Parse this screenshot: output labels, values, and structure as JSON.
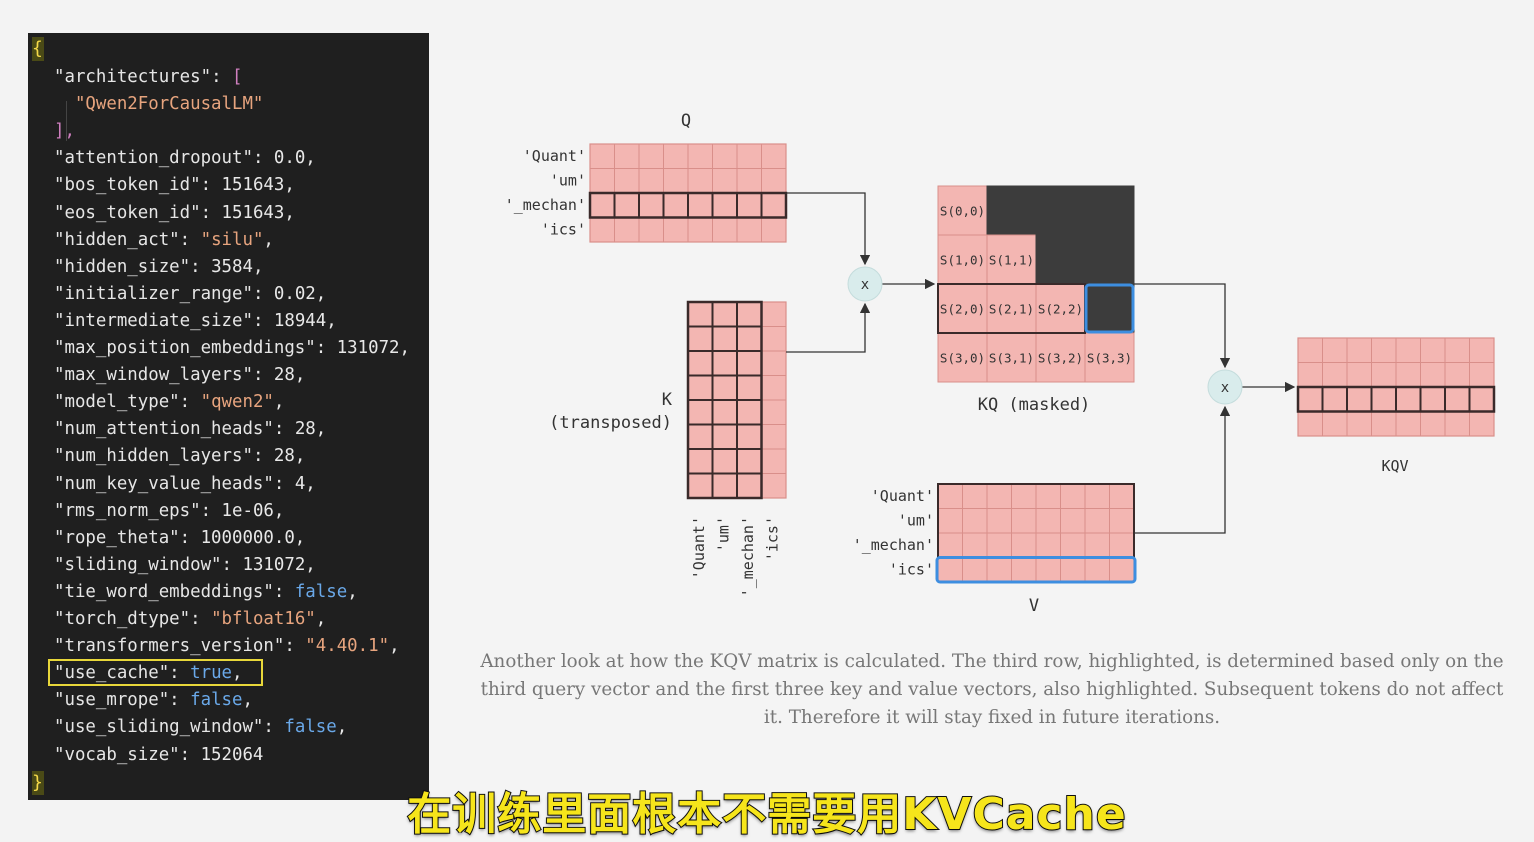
{
  "config_json": {
    "open_brace": "{",
    "close_brace": "}",
    "lines": [
      [
        {
          "t": "\"architectures\"",
          "c": "key"
        },
        {
          "t": ": ",
          "c": "num"
        },
        {
          "t": "[",
          "c": "bracket"
        }
      ],
      [
        {
          "t": "  \"Qwen2ForCausalLM\"",
          "c": "arr-str"
        }
      ],
      [
        {
          "t": "],",
          "c": "bracket"
        }
      ],
      [
        {
          "t": "\"attention_dropout\"",
          "c": "key"
        },
        {
          "t": ": 0.0,",
          "c": "num"
        }
      ],
      [
        {
          "t": "\"bos_token_id\"",
          "c": "key"
        },
        {
          "t": ": 151643,",
          "c": "num"
        }
      ],
      [
        {
          "t": "\"eos_token_id\"",
          "c": "key"
        },
        {
          "t": ": 151643,",
          "c": "num"
        }
      ],
      [
        {
          "t": "\"hidden_act\"",
          "c": "key"
        },
        {
          "t": ": ",
          "c": "num"
        },
        {
          "t": "\"silu\"",
          "c": "str"
        },
        {
          "t": ",",
          "c": "num"
        }
      ],
      [
        {
          "t": "\"hidden_size\"",
          "c": "key"
        },
        {
          "t": ": 3584,",
          "c": "num"
        }
      ],
      [
        {
          "t": "\"initializer_range\"",
          "c": "key"
        },
        {
          "t": ": 0.02,",
          "c": "num"
        }
      ],
      [
        {
          "t": "\"intermediate_size\"",
          "c": "key"
        },
        {
          "t": ": 18944,",
          "c": "num"
        }
      ],
      [
        {
          "t": "\"max_position_embeddings\"",
          "c": "key"
        },
        {
          "t": ": 131072,",
          "c": "num"
        }
      ],
      [
        {
          "t": "\"max_window_layers\"",
          "c": "key"
        },
        {
          "t": ": 28,",
          "c": "num"
        }
      ],
      [
        {
          "t": "\"model_type\"",
          "c": "key"
        },
        {
          "t": ": ",
          "c": "num"
        },
        {
          "t": "\"qwen2\"",
          "c": "str"
        },
        {
          "t": ",",
          "c": "num"
        }
      ],
      [
        {
          "t": "\"num_attention_heads\"",
          "c": "key"
        },
        {
          "t": ": 28,",
          "c": "num"
        }
      ],
      [
        {
          "t": "\"num_hidden_layers\"",
          "c": "key"
        },
        {
          "t": ": 28,",
          "c": "num"
        }
      ],
      [
        {
          "t": "\"num_key_value_heads\"",
          "c": "key"
        },
        {
          "t": ": 4,",
          "c": "num"
        }
      ],
      [
        {
          "t": "\"rms_norm_eps\"",
          "c": "key"
        },
        {
          "t": ": 1e-06,",
          "c": "num"
        }
      ],
      [
        {
          "t": "\"rope_theta\"",
          "c": "key"
        },
        {
          "t": ": 1000000.0,",
          "c": "num"
        }
      ],
      [
        {
          "t": "\"sliding_window\"",
          "c": "key"
        },
        {
          "t": ": 131072,",
          "c": "num"
        }
      ],
      [
        {
          "t": "\"tie_word_embeddings\"",
          "c": "key"
        },
        {
          "t": ": ",
          "c": "num"
        },
        {
          "t": "false",
          "c": "kw"
        },
        {
          "t": ",",
          "c": "num"
        }
      ],
      [
        {
          "t": "\"torch_dtype\"",
          "c": "key"
        },
        {
          "t": ": ",
          "c": "num"
        },
        {
          "t": "\"bfloat16\"",
          "c": "str"
        },
        {
          "t": ",",
          "c": "num"
        }
      ],
      [
        {
          "t": "\"transformers_version\"",
          "c": "key"
        },
        {
          "t": ": ",
          "c": "num"
        },
        {
          "t": "\"4.40.1\"",
          "c": "str"
        },
        {
          "t": ",",
          "c": "num"
        }
      ],
      [
        {
          "t": "\"use_cache\"",
          "c": "key"
        },
        {
          "t": ": ",
          "c": "num"
        },
        {
          "t": "true",
          "c": "kw"
        },
        {
          "t": ",",
          "c": "num"
        }
      ],
      [
        {
          "t": "\"use_mrope\"",
          "c": "key"
        },
        {
          "t": ": ",
          "c": "num"
        },
        {
          "t": "false",
          "c": "kw"
        },
        {
          "t": ",",
          "c": "num"
        }
      ],
      [
        {
          "t": "\"use_sliding_window\"",
          "c": "key"
        },
        {
          "t": ": ",
          "c": "num"
        },
        {
          "t": "false",
          "c": "kw"
        },
        {
          "t": ",",
          "c": "num"
        }
      ],
      [
        {
          "t": "\"vocab_size\"",
          "c": "key"
        },
        {
          "t": ": 152064",
          "c": "num"
        }
      ]
    ],
    "highlighted_line": 22
  },
  "diagram": {
    "q_label": "Q",
    "k_label_1": "K",
    "k_label_2": "(transposed)",
    "v_label": "V",
    "kq_label": "KQ (masked)",
    "kqv_label": "KQV",
    "multiply_symbol": "x",
    "tokens": [
      "'Quant'",
      "'um'",
      "'_mechan'",
      "'ics'"
    ],
    "kq_cells": [
      [
        "S(0,0)",
        null,
        null,
        null
      ],
      [
        "S(1,0)",
        "S(1,1)",
        null,
        null
      ],
      [
        "S(2,0)",
        "S(2,1)",
        "S(2,2)",
        null
      ],
      [
        "S(3,0)",
        "S(3,1)",
        "S(3,2)",
        "S(3,3)"
      ]
    ],
    "colors": {
      "cell_fill": "#f3b6b2",
      "cell_line": "#d98f8a",
      "mask_fill": "#3c3c3c",
      "highlight_dark": "#3a2a2a",
      "highlight_blue": "#3d8ee0",
      "op_fill": "#d9ecec",
      "arrow": "#333333"
    }
  },
  "caption": "Another look at how the KQV matrix is calculated. The third row, highlighted, is determined based only on the third query vector and the first three key and value vectors, also highlighted. Subsequent tokens do not affect it. Therefore it will stay fixed in future iterations.",
  "subtitle": "在训练里面根本不需要用KVCache"
}
